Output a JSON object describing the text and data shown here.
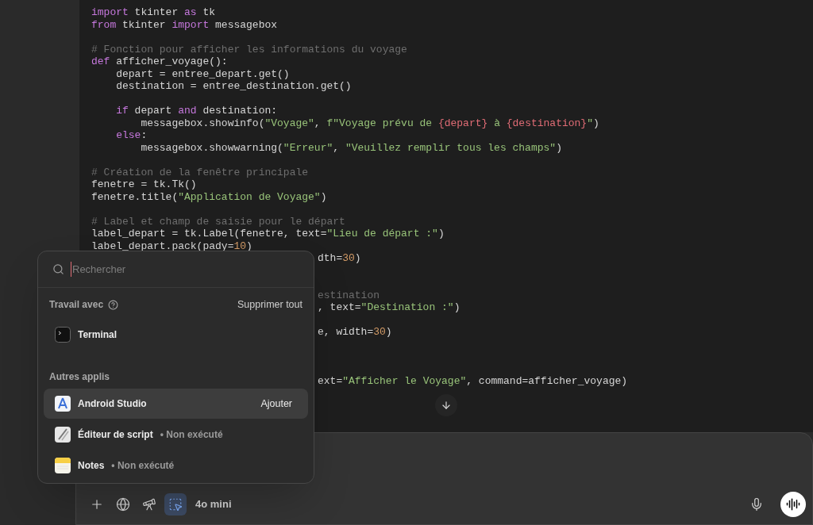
{
  "code": {
    "lines": [
      {
        "kind": "code",
        "tokens": [
          {
            "text": "import",
            "kind": "kw"
          },
          {
            "text": " tkinter ",
            "kind": "plain"
          },
          {
            "text": "as",
            "kind": "kw"
          },
          {
            "text": " tk",
            "kind": "plain"
          }
        ]
      },
      {
        "kind": "code",
        "tokens": [
          {
            "text": "from",
            "kind": "kw"
          },
          {
            "text": " tkinter ",
            "kind": "plain"
          },
          {
            "text": "import",
            "kind": "kw"
          },
          {
            "text": " messagebox",
            "kind": "plain"
          }
        ]
      },
      {
        "kind": "blank"
      },
      {
        "kind": "code",
        "tokens": [
          {
            "text": "# Fonction pour afficher les informations du voyage",
            "kind": "comment"
          }
        ]
      },
      {
        "kind": "code",
        "tokens": [
          {
            "text": "def",
            "kind": "kw"
          },
          {
            "text": " afficher_voyage():",
            "kind": "plain"
          }
        ]
      },
      {
        "kind": "code",
        "tokens": [
          {
            "text": "    depart = entree_depart.get()",
            "kind": "plain"
          }
        ]
      },
      {
        "kind": "code",
        "tokens": [
          {
            "text": "    destination = entree_destination.get()",
            "kind": "plain"
          }
        ]
      },
      {
        "kind": "blank"
      },
      {
        "kind": "code",
        "tokens": [
          {
            "text": "    if",
            "kind": "kw"
          },
          {
            "text": " depart ",
            "kind": "plain"
          },
          {
            "text": "and",
            "kind": "kw"
          },
          {
            "text": " destination:",
            "kind": "plain"
          }
        ]
      },
      {
        "kind": "code",
        "tokens": [
          {
            "text": "        messagebox.showinfo(",
            "kind": "plain"
          },
          {
            "text": "\"Voyage\"",
            "kind": "str"
          },
          {
            "text": ", ",
            "kind": "plain"
          },
          {
            "text": "f\"Voyage prévu de ",
            "kind": "str"
          },
          {
            "text": "{depart}",
            "kind": "interp"
          },
          {
            "text": " à ",
            "kind": "str"
          },
          {
            "text": "{destination}",
            "kind": "interp"
          },
          {
            "text": "\"",
            "kind": "str"
          },
          {
            "text": ")",
            "kind": "plain"
          }
        ]
      },
      {
        "kind": "code",
        "tokens": [
          {
            "text": "    else",
            "kind": "kw"
          },
          {
            "text": ":",
            "kind": "plain"
          }
        ]
      },
      {
        "kind": "code",
        "tokens": [
          {
            "text": "        messagebox.showwarning(",
            "kind": "plain"
          },
          {
            "text": "\"Erreur\"",
            "kind": "str"
          },
          {
            "text": ", ",
            "kind": "plain"
          },
          {
            "text": "\"Veuillez remplir tous les champs\"",
            "kind": "str"
          },
          {
            "text": ")",
            "kind": "plain"
          }
        ]
      },
      {
        "kind": "blank"
      },
      {
        "kind": "code",
        "tokens": [
          {
            "text": "# Création de la fenêtre principale",
            "kind": "comment"
          }
        ]
      },
      {
        "kind": "code",
        "tokens": [
          {
            "text": "fenetre = tk.Tk()",
            "kind": "plain"
          }
        ]
      },
      {
        "kind": "code",
        "tokens": [
          {
            "text": "fenetre.title(",
            "kind": "plain"
          },
          {
            "text": "\"Application de Voyage\"",
            "kind": "str"
          },
          {
            "text": ")",
            "kind": "plain"
          }
        ]
      },
      {
        "kind": "blank"
      },
      {
        "kind": "code",
        "tokens": [
          {
            "text": "# Label et champ de saisie pour le départ",
            "kind": "comment"
          }
        ]
      },
      {
        "kind": "code",
        "tokens": [
          {
            "text": "label_depart = tk.Label(fenetre, text=",
            "kind": "plain"
          },
          {
            "text": "\"Lieu de départ :\"",
            "kind": "str"
          },
          {
            "text": ")",
            "kind": "plain"
          }
        ]
      },
      {
        "kind": "code",
        "tokens": [
          {
            "text": "label_depart.pack(pady=",
            "kind": "plain"
          },
          {
            "text": "10",
            "kind": "num"
          },
          {
            "text": ")",
            "kind": "plain"
          }
        ]
      },
      {
        "kind": "partial",
        "tokens": [
          {
            "text": "dth=",
            "kind": "plain"
          },
          {
            "text": "30",
            "kind": "num"
          },
          {
            "text": ")",
            "kind": "plain"
          }
        ]
      },
      {
        "kind": "blank"
      },
      {
        "kind": "blank"
      },
      {
        "kind": "partial",
        "tokens": [
          {
            "text": "estination",
            "kind": "comment"
          }
        ]
      },
      {
        "kind": "partial",
        "tokens": [
          {
            "text": ", text=",
            "kind": "plain"
          },
          {
            "text": "\"Destination :\"",
            "kind": "str"
          },
          {
            "text": ")",
            "kind": "plain"
          }
        ]
      },
      {
        "kind": "blank"
      },
      {
        "kind": "partial",
        "tokens": [
          {
            "text": "e, width=",
            "kind": "plain"
          },
          {
            "text": "30",
            "kind": "num"
          },
          {
            "text": ")",
            "kind": "plain"
          }
        ]
      },
      {
        "kind": "blank"
      },
      {
        "kind": "blank"
      },
      {
        "kind": "blank"
      },
      {
        "kind": "partial",
        "tokens": [
          {
            "text": "ext=",
            "kind": "plain"
          },
          {
            "text": "\"Afficher le Voyage\"",
            "kind": "str"
          },
          {
            "text": ", command=afficher_voyage)",
            "kind": "plain"
          }
        ]
      }
    ]
  },
  "app_picker": {
    "search": {
      "placeholder": "Rechercher"
    },
    "working_with": {
      "title": "Travail avec",
      "clear": "Supprimer tout",
      "apps": [
        {
          "name": "Terminal",
          "kind": "terminal",
          "selected": false
        }
      ]
    },
    "other_apps": {
      "title": "Autres applis",
      "apps": [
        {
          "name": "Android Studio",
          "kind": "android-studio",
          "selected": true,
          "action": "Ajouter"
        },
        {
          "name": "Éditeur de script",
          "kind": "script-editor",
          "selected": false,
          "status": "• Non exécuté"
        },
        {
          "name": "Notes",
          "kind": "notes",
          "selected": false,
          "status": "• Non exécuté"
        }
      ]
    }
  },
  "composer": {
    "tools": [
      {
        "kind": "plus",
        "selected": false
      },
      {
        "kind": "globe",
        "selected": false
      },
      {
        "kind": "telescope",
        "selected": false
      },
      {
        "kind": "select",
        "selected": true
      }
    ],
    "model": "4o mini"
  }
}
